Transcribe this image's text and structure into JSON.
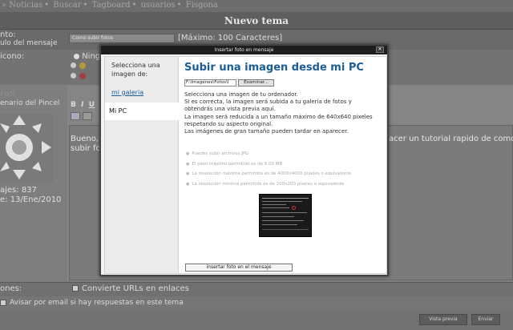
{
  "topnav": {
    "items": [
      "» Noticias",
      "Buscar",
      "Tagboard",
      "usuarios",
      "Fisgona"
    ]
  },
  "page": {
    "title": "Nuevo tema"
  },
  "form": {
    "subject_label": "nto:",
    "subject_sublabel": "ulo del mensaje",
    "subject_value": "Como subir fotos",
    "subject_max": "[Máximo: 100 Caracteres]",
    "icon_label": "icono:",
    "icon_option_none": "Ningu"
  },
  "user": {
    "name": "roS",
    "rank": "enario del Pincel",
    "posts": "ajes: 837",
    "joined": "e: 13/Ene/2010"
  },
  "editor": {
    "text_left_1": "Bueno,",
    "text_left_2": "subir fo",
    "text_right": "acer un tutorial rapido de como"
  },
  "options": {
    "label": "ones:",
    "convert_urls": "Convierte URLs en enlaces",
    "notify": "Avisar por email si hay respuestas en este tema"
  },
  "buttons": {
    "preview": "Vista previa",
    "send": "Enviar"
  },
  "modal": {
    "title": "Insertar foto en mensaje",
    "close_icon": "close-icon",
    "side_heading": "Selecciona una imagen de:",
    "side_link": "mi galeria",
    "side_active": "Mi PC",
    "heading": "Subir una imagen desde mi PC",
    "file_value": "F:\\Imagenes\\Fotos\\I",
    "file_button": "Examinar...",
    "desc": [
      "Selecciona una imagen de tu ordenador.",
      "Si es correcta, la imagen será subida a tu galería de fotos y",
      "obtendrás una vista previa aquí.",
      "La imagen será reducida a un tamaño máximo de 640x640 pixeles",
      "respetando su aspecto original.",
      "Las imágenes de gran tamaño pueden tardar en aparecer."
    ],
    "rules": [
      "Puedes subir archivos JPG",
      "El peso máximo permitido es de 6.00 MB",
      "La resolución máxima permitida es de 4000x4000 píxeles o equivalente",
      "La resolución mínima permitida es de 200x200 píxeles o equivalente"
    ],
    "insert_button": "insertar foto en el mensaje"
  }
}
